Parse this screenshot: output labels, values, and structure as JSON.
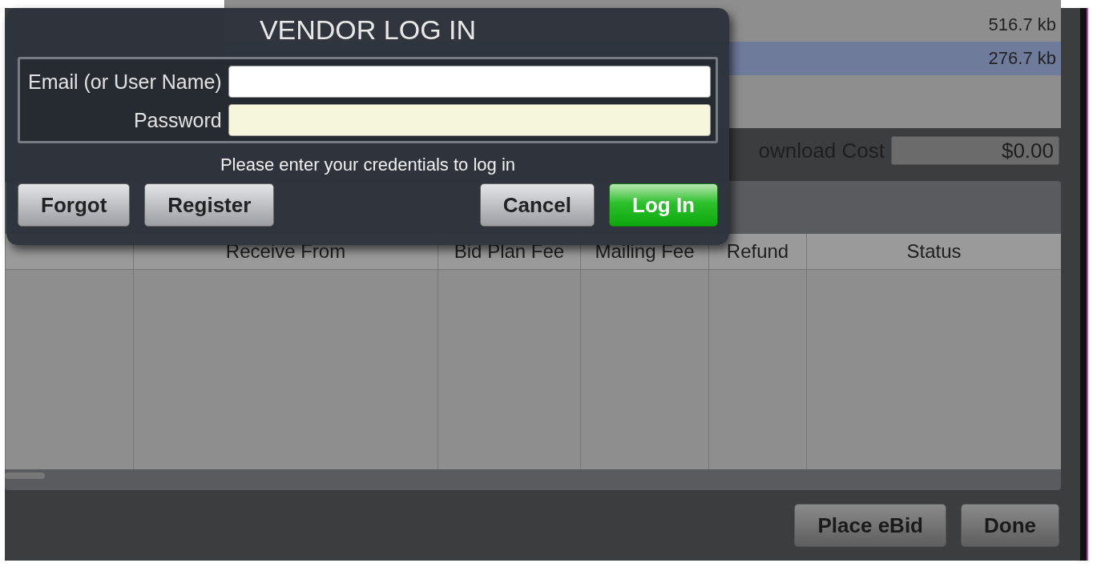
{
  "dialog": {
    "title": "VENDOR LOG IN",
    "fields": [
      {
        "label": "Email (or User Name)",
        "highlighted": false
      },
      {
        "label": "Password",
        "highlighted": true
      }
    ],
    "message": "Please enter your credentials to log in",
    "buttons": [
      {
        "label": "Forgot",
        "kind": "secondary"
      },
      {
        "label": "Register",
        "kind": "secondary"
      },
      {
        "label": "Cancel",
        "kind": "secondary"
      },
      {
        "label": "Log In",
        "kind": "primary"
      }
    ]
  },
  "files": {
    "rows": [
      {
        "size": "516.7 kb",
        "selected": false
      },
      {
        "size": "276.7 kb",
        "selected": true
      }
    ]
  },
  "download_cost": {
    "label": "ownload Cost",
    "value": "$0.00"
  },
  "table": {
    "columns": [
      "Receive From",
      "Bid Plan Fee",
      "Mailing Fee",
      "Refund",
      "Status"
    ]
  },
  "footer_buttons": [
    "Place eBid",
    "Done"
  ]
}
